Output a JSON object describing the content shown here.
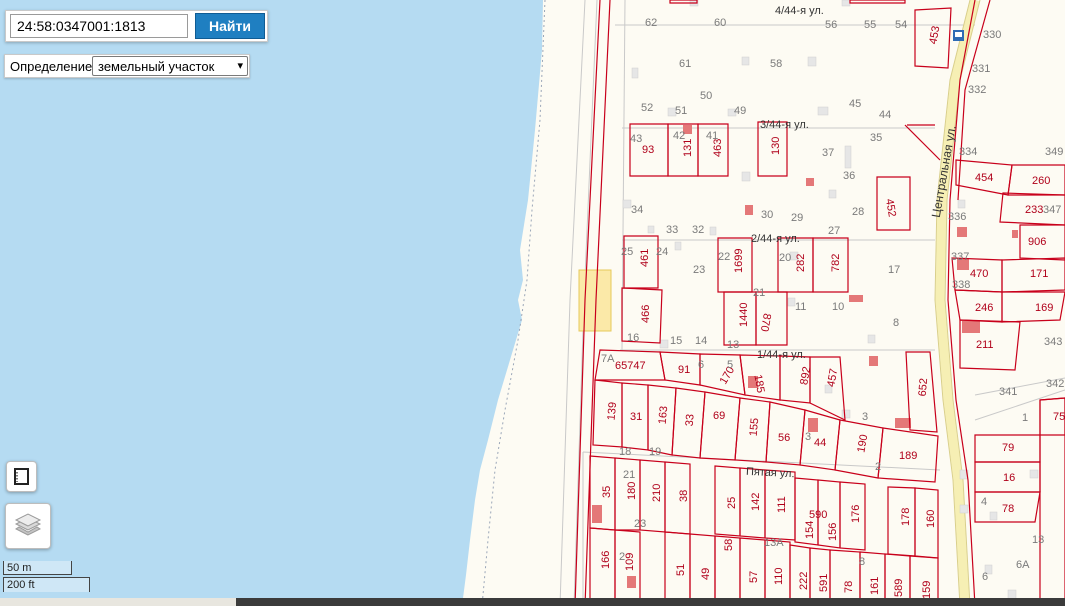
{
  "search": {
    "value": "24:58:0347001:1813",
    "button_label": "Найти"
  },
  "definition": {
    "label": "Определение:",
    "selected": "земельный участок"
  },
  "scale": {
    "metric": "50 m",
    "imperial": "200 ft"
  },
  "streets": [
    "4/44-я ул.",
    "3/44-я ул.",
    "2/44-я ул.",
    "1/44-я ул.",
    "Пятая ул.",
    "Центральная ул."
  ],
  "parcel_labels": [
    "453",
    "93",
    "131",
    "463",
    "130",
    "452",
    "454",
    "260",
    "233",
    "906",
    "461",
    "1699",
    "282",
    "782",
    "470",
    "171",
    "466",
    "1440",
    "870",
    "246",
    "169",
    "211",
    "65747",
    "91",
    "170",
    "185",
    "892",
    "457",
    "652",
    "139",
    "31",
    "163",
    "33",
    "69",
    "155",
    "56",
    "44",
    "190",
    "189",
    "79",
    "16",
    "78",
    "35",
    "180",
    "210",
    "38",
    "25",
    "142",
    "111",
    "590",
    "154",
    "156",
    "176",
    "178",
    "160",
    "166",
    "109",
    "51",
    "49",
    "58",
    "57",
    "110",
    "222",
    "591",
    "78",
    "161",
    "589",
    "159",
    "75"
  ],
  "house_numbers": [
    "62",
    "60",
    "56",
    "55",
    "54",
    "330",
    "61",
    "58",
    "331",
    "332",
    "50",
    "52",
    "51",
    "49",
    "45",
    "44",
    "43",
    "42",
    "41",
    "35",
    "37",
    "36",
    "34",
    "33",
    "32",
    "30",
    "29",
    "28",
    "27",
    "334",
    "349",
    "347",
    "336",
    "25",
    "24",
    "23",
    "22",
    "20",
    "17",
    "337",
    "338",
    "21",
    "11",
    "10",
    "16",
    "15",
    "14",
    "13",
    "8",
    "343",
    "7А",
    "6",
    "5",
    "3",
    "2",
    "341",
    "342",
    "1",
    "18",
    "19",
    "21",
    "23",
    "13А",
    "4",
    "13",
    "3",
    "6",
    "6А",
    "2",
    "8"
  ],
  "icons": {
    "layers": "layers-icon",
    "toggle": "map-toggle-icon",
    "bus_stop": "bus-stop-icon"
  },
  "colors": {
    "water": "#b5dbf2",
    "land": "#fdfbf3",
    "parcel": "#c8001b",
    "building": "#e8e8e8",
    "highlight": "#fbe9a8"
  }
}
